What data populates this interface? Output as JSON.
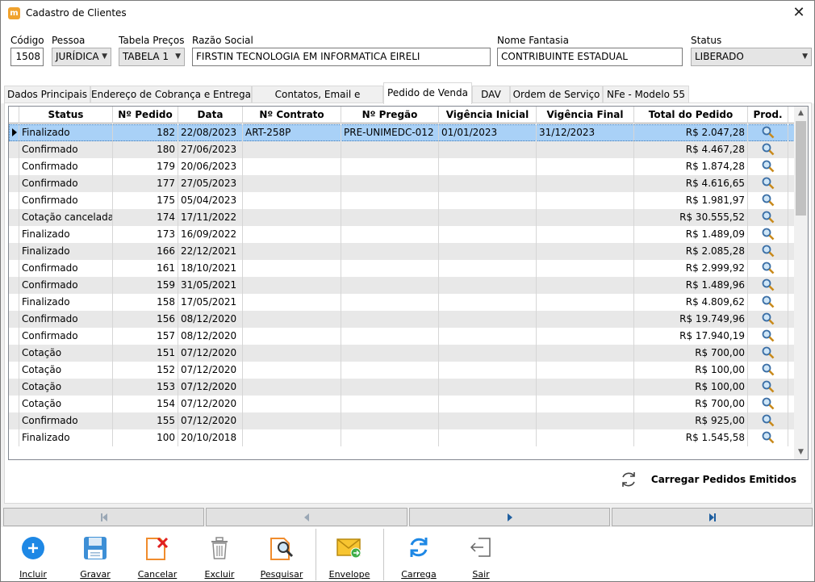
{
  "window": {
    "title": "Cadastro de Clientes",
    "app_icon_letter": "m"
  },
  "form": {
    "codigo": {
      "label": "Código",
      "value": "1508"
    },
    "pessoa": {
      "label": "Pessoa",
      "value": "JURÍDICA"
    },
    "tabela": {
      "label": "Tabela Preços",
      "value": "TABELA 1"
    },
    "razao": {
      "label": "Razão Social",
      "value": "FIRSTIN TECNOLOGIA EM INFORMATICA EIRELI"
    },
    "fantasia": {
      "label": "Nome Fantasia",
      "value": "CONTRIBUINTE ESTADUAL"
    },
    "status": {
      "label": "Status",
      "value": "LIBERADO"
    }
  },
  "tabs": [
    {
      "label": "Dados Principais"
    },
    {
      "label": "Endereço de Cobrança e Entrega"
    },
    {
      "label": "Contatos, Email e Diversos"
    },
    {
      "label": "Pedido de Venda"
    },
    {
      "label": "DAV"
    },
    {
      "label": "Ordem de Serviço"
    },
    {
      "label": "NFe - Modelo 55"
    }
  ],
  "grid": {
    "headers": [
      "Status",
      "Nº Pedido",
      "Data",
      "Nº Contrato",
      "Nº Pregão",
      "Vigência Inicial",
      "Vigência Final",
      "Total do Pedido",
      "Prod."
    ],
    "rows": [
      {
        "status": "Finalizado",
        "pedido": "182",
        "data": "22/08/2023",
        "contrato": "ART-258P",
        "pregao": "PRE-UNIMEDC-012",
        "vig_ini": "01/01/2023",
        "vig_fim": "31/12/2023",
        "total": "R$ 2.047,28"
      },
      {
        "status": "Confirmado",
        "pedido": "180",
        "data": "27/06/2023",
        "contrato": "",
        "pregao": "",
        "vig_ini": "",
        "vig_fim": "",
        "total": "R$ 4.467,28"
      },
      {
        "status": "Confirmado",
        "pedido": "179",
        "data": "20/06/2023",
        "contrato": "",
        "pregao": "",
        "vig_ini": "",
        "vig_fim": "",
        "total": "R$ 1.874,28"
      },
      {
        "status": "Confirmado",
        "pedido": "177",
        "data": "27/05/2023",
        "contrato": "",
        "pregao": "",
        "vig_ini": "",
        "vig_fim": "",
        "total": "R$ 4.616,65"
      },
      {
        "status": "Confirmado",
        "pedido": "175",
        "data": "05/04/2023",
        "contrato": "",
        "pregao": "",
        "vig_ini": "",
        "vig_fim": "",
        "total": "R$ 1.981,97"
      },
      {
        "status": "Cotação cancelada",
        "pedido": "174",
        "data": "17/11/2022",
        "contrato": "",
        "pregao": "",
        "vig_ini": "",
        "vig_fim": "",
        "total": "R$ 30.555,52"
      },
      {
        "status": "Finalizado",
        "pedido": "173",
        "data": "16/09/2022",
        "contrato": "",
        "pregao": "",
        "vig_ini": "",
        "vig_fim": "",
        "total": "R$ 1.489,09"
      },
      {
        "status": "Finalizado",
        "pedido": "166",
        "data": "22/12/2021",
        "contrato": "",
        "pregao": "",
        "vig_ini": "",
        "vig_fim": "",
        "total": "R$ 2.085,28"
      },
      {
        "status": "Confirmado",
        "pedido": "161",
        "data": "18/10/2021",
        "contrato": "",
        "pregao": "",
        "vig_ini": "",
        "vig_fim": "",
        "total": "R$ 2.999,92"
      },
      {
        "status": "Confirmado",
        "pedido": "159",
        "data": "31/05/2021",
        "contrato": "",
        "pregao": "",
        "vig_ini": "",
        "vig_fim": "",
        "total": "R$ 1.489,96"
      },
      {
        "status": "Finalizado",
        "pedido": "158",
        "data": "17/05/2021",
        "contrato": "",
        "pregao": "",
        "vig_ini": "",
        "vig_fim": "",
        "total": "R$ 4.809,62"
      },
      {
        "status": "Confirmado",
        "pedido": "156",
        "data": "08/12/2020",
        "contrato": "",
        "pregao": "",
        "vig_ini": "",
        "vig_fim": "",
        "total": "R$ 19.749,96"
      },
      {
        "status": "Confirmado",
        "pedido": "157",
        "data": "08/12/2020",
        "contrato": "",
        "pregao": "",
        "vig_ini": "",
        "vig_fim": "",
        "total": "R$ 17.940,19"
      },
      {
        "status": "Cotação",
        "pedido": "151",
        "data": "07/12/2020",
        "contrato": "",
        "pregao": "",
        "vig_ini": "",
        "vig_fim": "",
        "total": "R$ 700,00"
      },
      {
        "status": "Cotação",
        "pedido": "152",
        "data": "07/12/2020",
        "contrato": "",
        "pregao": "",
        "vig_ini": "",
        "vig_fim": "",
        "total": "R$ 100,00"
      },
      {
        "status": "Cotação",
        "pedido": "153",
        "data": "07/12/2020",
        "contrato": "",
        "pregao": "",
        "vig_ini": "",
        "vig_fim": "",
        "total": "R$ 100,00"
      },
      {
        "status": "Cotação",
        "pedido": "154",
        "data": "07/12/2020",
        "contrato": "",
        "pregao": "",
        "vig_ini": "",
        "vig_fim": "",
        "total": "R$ 700,00"
      },
      {
        "status": "Confirmado",
        "pedido": "155",
        "data": "07/12/2020",
        "contrato": "",
        "pregao": "",
        "vig_ini": "",
        "vig_fim": "",
        "total": "R$ 925,00"
      },
      {
        "status": "Finalizado",
        "pedido": "100",
        "data": "20/10/2018",
        "contrato": "",
        "pregao": "",
        "vig_ini": "",
        "vig_fim": "",
        "total": "R$ 1.545,58"
      }
    ]
  },
  "reload_label": "Carregar Pedidos Emitidos",
  "toolbar": {
    "incluir": "Incluir",
    "gravar": "Gravar",
    "cancelar": "Cancelar",
    "excluir": "Excluir",
    "pesquisar": "Pesquisar",
    "envelope": "Envelope",
    "carregar_todos": "Carrega Todos",
    "sair": "Sair"
  },
  "colors": {
    "selected_row": "#a9d1f7",
    "alt_row": "#e8e8e8",
    "accent_blue": "#1e88e5",
    "app_icon": "#f0a22e"
  }
}
